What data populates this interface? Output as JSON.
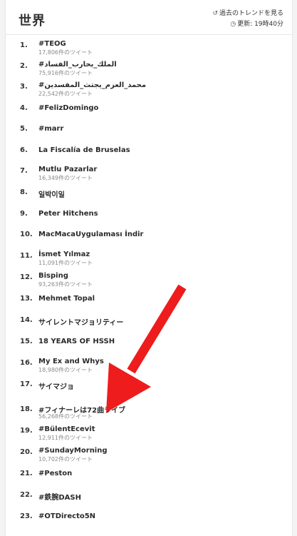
{
  "header": {
    "title": "世界",
    "past_trends_label": "過去のトレンドを見る",
    "updated_label": "更新: 19時40分"
  },
  "icons": {
    "history": "history-icon",
    "clock": "clock-icon"
  },
  "colors": {
    "arrow": "#ee1c1c"
  },
  "trends": [
    {
      "rank": "1.",
      "name": "#TEOG",
      "count": "17,806件のツイート"
    },
    {
      "rank": "2.",
      "name": "#الملك_يحارب_الفساد",
      "count": "75,916件のツイート"
    },
    {
      "rank": "3.",
      "name": "#محمد_العزم_يجتث_المفسدين",
      "count": "22,542件のツイート"
    },
    {
      "rank": "4.",
      "name": "#FelizDomingo",
      "count": ""
    },
    {
      "rank": "5.",
      "name": "#marr",
      "count": ""
    },
    {
      "rank": "6.",
      "name": "La Fiscalía de Bruselas",
      "count": ""
    },
    {
      "rank": "7.",
      "name": "Mutlu Pazarlar",
      "count": "16,349件のツイート"
    },
    {
      "rank": "8.",
      "name": "일박이일",
      "count": ""
    },
    {
      "rank": "9.",
      "name": "Peter Hitchens",
      "count": ""
    },
    {
      "rank": "10.",
      "name": "MacMacaUygulaması İndir",
      "count": ""
    },
    {
      "rank": "11.",
      "name": "İsmet Yılmaz",
      "count": "11,091件のツイート"
    },
    {
      "rank": "12.",
      "name": "Bisping",
      "count": "93,263件のツイート"
    },
    {
      "rank": "13.",
      "name": "Mehmet Topal",
      "count": ""
    },
    {
      "rank": "14.",
      "name": "サイレントマジョリティー",
      "count": ""
    },
    {
      "rank": "15.",
      "name": "18 YEARS OF HSSH",
      "count": ""
    },
    {
      "rank": "16.",
      "name": "My Ex and Whys",
      "count": "18,980件のツイート"
    },
    {
      "rank": "17.",
      "name": "サイマジョ",
      "count": ""
    },
    {
      "rank": "18.",
      "name": "#フィナーレは72曲ライブ",
      "count": "56,268件のツイート"
    },
    {
      "rank": "19.",
      "name": "#BülentEcevit",
      "count": "12,911件のツイート"
    },
    {
      "rank": "20.",
      "name": "#SundayMorning",
      "count": "10,702件のツイート"
    },
    {
      "rank": "21.",
      "name": "#Peston",
      "count": ""
    },
    {
      "rank": "22.",
      "name": "#鉄腕DASH",
      "count": ""
    },
    {
      "rank": "23.",
      "name": "#OTDirecto5N",
      "count": ""
    }
  ]
}
